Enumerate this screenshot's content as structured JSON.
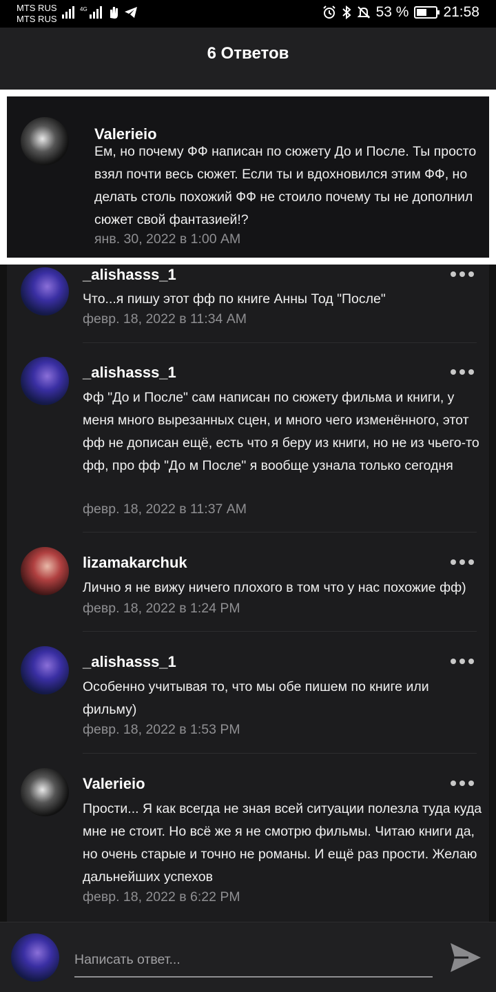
{
  "status_bar": {
    "carrier1": "MTS RUS",
    "carrier2": "MTS RUS",
    "battery_percent": "53 %",
    "battery_level": 0.53,
    "time": "21:58"
  },
  "header": {
    "title": "6 Ответов"
  },
  "highlighted_comment": {
    "username": "Valerieio",
    "text": "Ем, но почему ФФ написан по сюжету До и После. Ты просто взял почти весь сюжет. Если ты и вдохновился этим ФФ, но делать столь похожий ФФ не стоило почему ты не дополнил сюжет свой фантазией!?",
    "time": "янв. 30, 2022 в 1:00 AM"
  },
  "replies": [
    {
      "username": "_alishasss_1",
      "text": "Что...я пишу этот фф по книге Анны Тод \"После\"",
      "time": "февр. 18, 2022 в 11:34 AM"
    },
    {
      "username": "_alishasss_1",
      "text": "Фф \"До и После\" сам написан по сюжету фильма и книги, у меня много вырезанных сцен, и много чего изменённого, этот фф не дописан ещё, есть что я беру из книги, но не из чьего-то фф, про фф \"До м После\" я вообще узнала только сегодня",
      "time": "февр. 18, 2022 в 11:37 AM"
    },
    {
      "username": "lizamakarchuk",
      "text": "Лично я не вижу ничего плохого в том что у нас похожие фф)",
      "time": "февр. 18, 2022 в 1:24 PM"
    },
    {
      "username": "_alishasss_1",
      "text": "Особенно учитывая то, что мы обе пишем по книге или фильму)",
      "time": "февр. 18, 2022 в 1:53 PM"
    },
    {
      "username": "Valerieio",
      "text": "Прости... Я как всегда не зная всей ситуации полезла туда куда мне не стоит. Но всё же я не смотрю фильмы. Читаю книги да, но очень старые и точно не романы. И ещё раз прости. Желаю дальнейших успехов",
      "time": "февр. 18, 2022 в 6:22 PM"
    }
  ],
  "reply_box": {
    "placeholder": "Написать ответ..."
  },
  "icons": {
    "signal": "signal-bars-icon",
    "alarm": "alarm-icon",
    "bluetooth": "bluetooth-icon",
    "mute": "bell-off-icon",
    "battery": "battery-icon",
    "send": "send-icon",
    "more": "more-dots-icon"
  }
}
